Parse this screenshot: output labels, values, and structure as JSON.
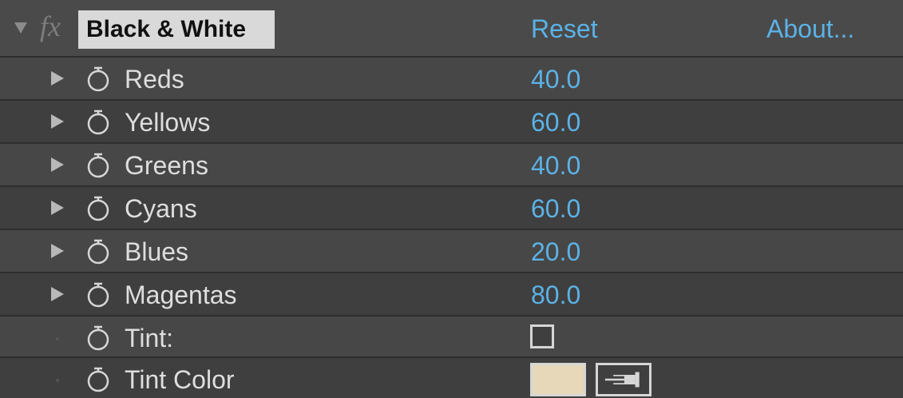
{
  "effect": {
    "name": "Black & White",
    "fx_label": "fx",
    "reset_label": "Reset",
    "about_label": "About..."
  },
  "properties": [
    {
      "label": "Reds",
      "value": "40.0"
    },
    {
      "label": "Yellows",
      "value": "60.0"
    },
    {
      "label": "Greens",
      "value": "40.0"
    },
    {
      "label": "Cyans",
      "value": "60.0"
    },
    {
      "label": "Blues",
      "value": "20.0"
    },
    {
      "label": "Magentas",
      "value": "80.0"
    },
    {
      "label": "Tint:",
      "checked": false
    },
    {
      "label": "Tint Color",
      "color": "#e6d8b8"
    }
  ],
  "colors": {
    "value_blue": "#5bb2e6",
    "panel_bg": "#3b3b3b",
    "header_bg": "#4a4a4a"
  },
  "icons": [
    "twirl-down-icon",
    "fx-icon",
    "twirl-right-icon",
    "stopwatch-icon",
    "eyedropper-icon"
  ]
}
